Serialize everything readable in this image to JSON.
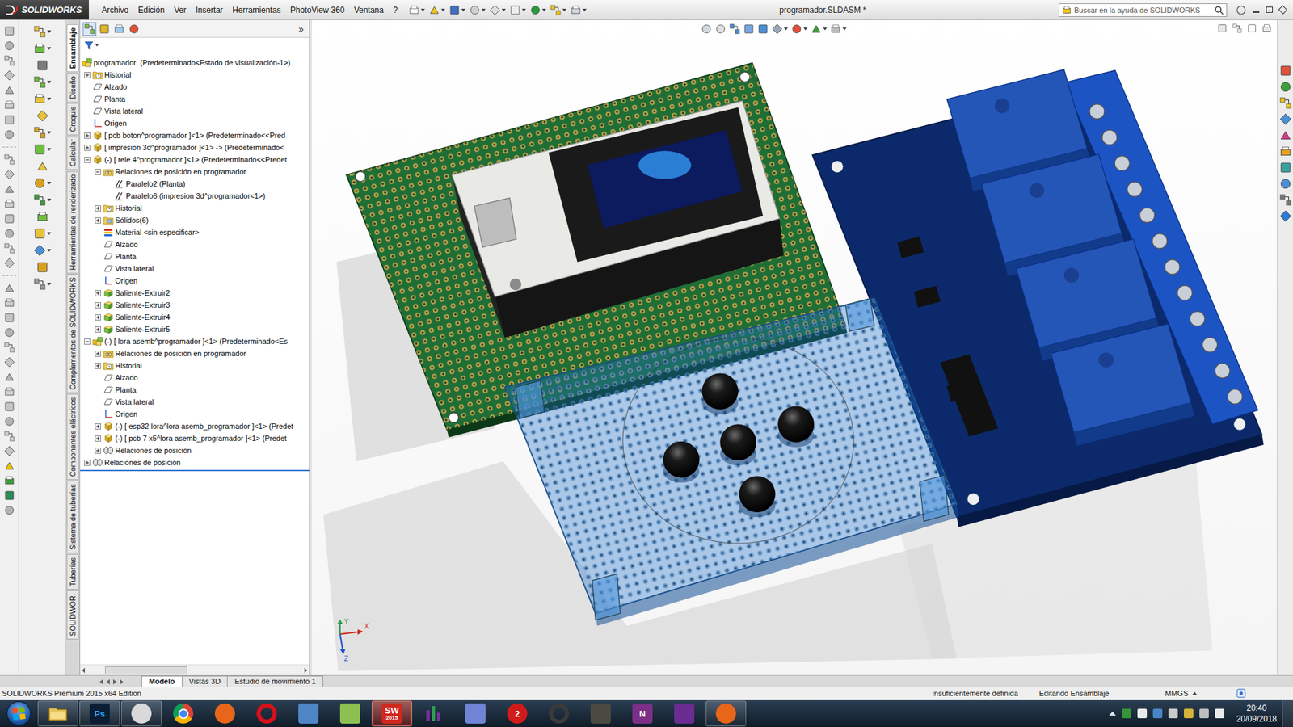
{
  "app": {
    "logo": "SOLIDWORKS"
  },
  "menu": [
    "Archivo",
    "Edición",
    "Ver",
    "Insertar",
    "Herramientas",
    "PhotoView 360",
    "Ventana",
    "?"
  ],
  "window": {
    "title": "programador.SLDASM *"
  },
  "search": {
    "placeholder": "Buscar en la ayuda de SOLIDWORKS"
  },
  "command_tabs": [
    {
      "label": "Ensamblaje",
      "selected": true
    },
    {
      "label": "Diseño",
      "selected": false
    },
    {
      "label": "Croquis",
      "selected": false
    },
    {
      "label": "Calcular",
      "selected": false
    },
    {
      "label": "Herramientas de renderizado",
      "selected": false
    },
    {
      "label": "Complementos de SOLIDWORKS",
      "selected": false
    },
    {
      "label": "Componentes eléctricos",
      "selected": false
    },
    {
      "label": "Sistema de tuberías",
      "selected": false
    },
    {
      "label": "Tuberías",
      "selected": false
    },
    {
      "label": "SOLIDWOR.",
      "selected": false
    }
  ],
  "feature_manager": {
    "panel_tabs": [
      {
        "selected": true
      },
      {
        "selected": false
      },
      {
        "selected": false
      },
      {
        "selected": false
      }
    ],
    "expand_glyph": "»",
    "tree": [
      {
        "label": "programador  (Predeterminado<Estado de visualización-1>)",
        "level": 0,
        "kind": "assembly",
        "expandable": false,
        "expanded": false
      },
      {
        "label": "Historial",
        "level": 1,
        "kind": "history",
        "expandable": true,
        "expanded": false
      },
      {
        "label": "Alzado",
        "level": 1,
        "kind": "plane",
        "expandable": false,
        "expanded": false
      },
      {
        "label": "Planta",
        "level": 1,
        "kind": "plane",
        "expandable": false,
        "expanded": false
      },
      {
        "label": "Vista lateral",
        "level": 1,
        "kind": "plane",
        "expandable": false,
        "expanded": false
      },
      {
        "label": "Origen",
        "level": 1,
        "kind": "origin",
        "expandable": false,
        "expanded": false
      },
      {
        "label": "[ pcb boton^programador ]<1> (Predeterminado<<Pred",
        "level": 1,
        "kind": "part",
        "expandable": true,
        "expanded": false
      },
      {
        "label": "[ impresion 3d^programador ]<1> -> (Predeterminado<",
        "level": 1,
        "kind": "part",
        "expandable": true,
        "expanded": false
      },
      {
        "label": "(-) [ rele 4^programador ]<1> (Predeterminado<<Predet",
        "level": 1,
        "kind": "part",
        "expandable": true,
        "expanded": true
      },
      {
        "label": "Relaciones de posición en programador",
        "level": 2,
        "kind": "mates",
        "expandable": true,
        "expanded": true
      },
      {
        "label": "Paralelo2 (Planta)",
        "level": 3,
        "kind": "mate",
        "expandable": false,
        "expanded": false
      },
      {
        "label": "Paralelo6 (impresion 3d^programador<1>)",
        "level": 3,
        "kind": "mate",
        "expandable": false,
        "expanded": false
      },
      {
        "label": "Historial",
        "level": 2,
        "kind": "history",
        "expandable": true,
        "expanded": false
      },
      {
        "label": "Sólidos(6)",
        "level": 2,
        "kind": "solids",
        "expandable": true,
        "expanded": false
      },
      {
        "label": "Material <sin especificar>",
        "level": 2,
        "kind": "material",
        "expandable": false,
        "expanded": false
      },
      {
        "label": "Alzado",
        "level": 2,
        "kind": "plane",
        "expandable": false,
        "expanded": false
      },
      {
        "label": "Planta",
        "level": 2,
        "kind": "plane",
        "expandable": false,
        "expanded": false
      },
      {
        "label": "Vista lateral",
        "level": 2,
        "kind": "plane",
        "expandable": false,
        "expanded": false
      },
      {
        "label": "Origen",
        "level": 2,
        "kind": "origin",
        "expandable": false,
        "expanded": false
      },
      {
        "label": "Saliente-Extruir2",
        "level": 2,
        "kind": "feature",
        "expandable": true,
        "expanded": false
      },
      {
        "label": "Saliente-Extruir3",
        "level": 2,
        "kind": "feature",
        "expandable": true,
        "expanded": false
      },
      {
        "label": "Saliente-Extruir4",
        "level": 2,
        "kind": "feature",
        "expandable": true,
        "expanded": false
      },
      {
        "label": "Saliente-Extruir5",
        "level": 2,
        "kind": "feature",
        "expandable": true,
        "expanded": false
      },
      {
        "label": "(-) [ lora asemb^programador ]<1> (Predeterminado<Es",
        "level": 1,
        "kind": "assembly",
        "expandable": true,
        "expanded": true
      },
      {
        "label": "Relaciones de posición en programador",
        "level": 2,
        "kind": "mates",
        "expandable": true,
        "expanded": false
      },
      {
        "label": "Historial",
        "level": 2,
        "kind": "history",
        "expandable": true,
        "expanded": false
      },
      {
        "label": "Alzado",
        "level": 2,
        "kind": "plane",
        "expandable": false,
        "expanded": false
      },
      {
        "label": "Planta",
        "level": 2,
        "kind": "plane",
        "expandable": false,
        "expanded": false
      },
      {
        "label": "Vista lateral",
        "level": 2,
        "kind": "plane",
        "expandable": false,
        "expanded": false
      },
      {
        "label": "Origen",
        "level": 2,
        "kind": "origin",
        "expandable": false,
        "expanded": false
      },
      {
        "label": "(-) [ esp32 lora^lora asemb_programador ]<1> (Predet",
        "level": 2,
        "kind": "part",
        "expandable": true,
        "expanded": false
      },
      {
        "label": "(-) [ pcb 7 x5^lora asemb_programador ]<1> (Predet",
        "level": 2,
        "kind": "part",
        "expandable": true,
        "expanded": false
      },
      {
        "label": "Relaciones de posición",
        "level": 2,
        "kind": "mate-folder",
        "expandable": true,
        "expanded": false
      },
      {
        "label": "Relaciones de posición",
        "level": 1,
        "kind": "mate-folder",
        "expandable": true,
        "expanded": false
      }
    ]
  },
  "viewport": {
    "triad": {
      "x": "X",
      "y": "Y",
      "z": "Z"
    }
  },
  "bottom_tabs": [
    {
      "label": "Modelo",
      "selected": true
    },
    {
      "label": "Vistas 3D",
      "selected": false
    },
    {
      "label": "Estudio de movimiento 1",
      "selected": false
    }
  ],
  "status_bar": {
    "product": "SOLIDWORKS Premium 2015 x64 Edition",
    "state": "Insuficientemente definida",
    "mode": "Editando Ensamblaje",
    "units": "MMGS"
  },
  "taskbar": {
    "apps": [
      {
        "kind": "folder",
        "color": "#e7c15a",
        "running": true,
        "selected": false
      },
      {
        "kind": "square",
        "color": "#0a1d33",
        "glyph": "Ps",
        "glyph_color": "#31a8ff",
        "running": true,
        "selected": false
      },
      {
        "kind": "circle",
        "color": "#d9d9d9",
        "running": true,
        "selected": false
      },
      {
        "kind": "chrome",
        "color": "#0f9d58",
        "running": false,
        "selected": false
      },
      {
        "kind": "circle",
        "color": "#e8661a",
        "running": false,
        "selected": false
      },
      {
        "kind": "ring",
        "color": "#d8101a",
        "running": false,
        "selected": false
      },
      {
        "kind": "square",
        "color": "#4f86c6",
        "running": false,
        "selected": false
      },
      {
        "kind": "square",
        "color": "#8cc152",
        "running": false,
        "selected": false
      },
      {
        "kind": "square",
        "color": "#d0281e",
        "glyph": "SW",
        "sub": "2015",
        "glyph_color": "#ffffff",
        "running": true,
        "selected": true
      },
      {
        "kind": "bars",
        "color": "#7a2fa0",
        "running": false,
        "selected": false
      },
      {
        "kind": "square",
        "color": "#6f84d4",
        "running": false,
        "selected": false
      },
      {
        "kind": "circle",
        "color": "#d11b1b",
        "glyph": "2",
        "glyph_color": "#ffffff",
        "running": false,
        "selected": false
      },
      {
        "kind": "ring",
        "color": "#3a3a3a",
        "running": false,
        "selected": false
      },
      {
        "kind": "square",
        "color": "#4a4a40",
        "running": false,
        "selected": false
      },
      {
        "kind": "square",
        "color": "#7b2f86",
        "glyph": "N",
        "glyph_color": "#ffffff",
        "running": false,
        "selected": false
      },
      {
        "kind": "square",
        "color": "#6a2c91",
        "running": false,
        "selected": false
      },
      {
        "kind": "circle",
        "color": "#e8661a",
        "running": true,
        "selected": false
      }
    ],
    "clock": {
      "time": "20:40",
      "date": "20/09/2018"
    }
  }
}
